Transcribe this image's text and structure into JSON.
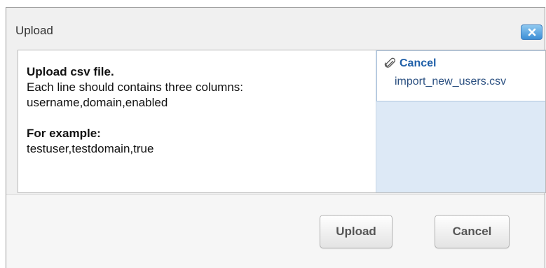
{
  "dialog": {
    "title": "Upload",
    "close_icon": "close-x-icon"
  },
  "info": {
    "heading": "Upload csv file.",
    "line1": "Each line should contains three columns:",
    "line2": "username,domain,enabled",
    "example_heading": "For example:",
    "example_line": "testuser,testdomain,true"
  },
  "upload_panel": {
    "cancel_label": "Cancel",
    "cancel_icon": "paperclip-icon",
    "file_name": "import_new_users.csv"
  },
  "footer": {
    "upload_label": "Upload",
    "cancel_label": "Cancel"
  },
  "colors": {
    "accent": "#3d8fd6",
    "panel_bg": "#dde9f6",
    "link": "#1f5fa8"
  }
}
